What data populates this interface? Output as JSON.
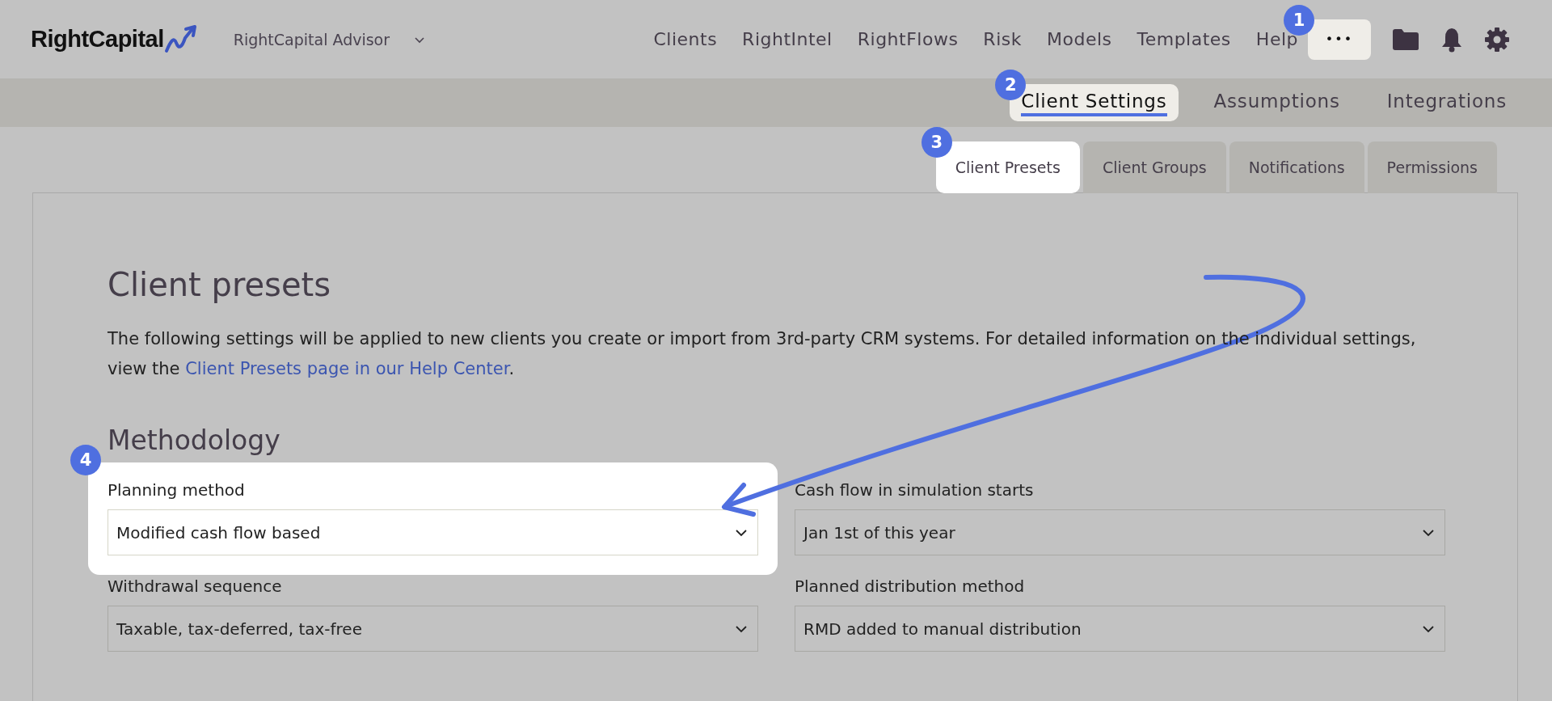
{
  "header": {
    "logo": "RightCapital",
    "account": "RightCapital Advisor",
    "nav": [
      {
        "label": "Clients"
      },
      {
        "label": "RightIntel"
      },
      {
        "label": "RightFlows"
      },
      {
        "label": "Risk"
      },
      {
        "label": "Models"
      },
      {
        "label": "Templates"
      },
      {
        "label": "Help"
      }
    ],
    "more_button": {
      "label": "•••",
      "callout": "1"
    }
  },
  "subnav": [
    {
      "label": "Client Settings",
      "selected": true,
      "callout": "2"
    },
    {
      "label": "Assumptions",
      "selected": false
    },
    {
      "label": "Integrations",
      "selected": false
    }
  ],
  "tabs": [
    {
      "label": "Client Presets",
      "selected": true,
      "callout": "3"
    },
    {
      "label": "Client Groups",
      "selected": false
    },
    {
      "label": "Notifications",
      "selected": false
    },
    {
      "label": "Permissions",
      "selected": false
    }
  ],
  "page": {
    "title": "Client presets",
    "intro": "The following settings will be applied to new clients you create or import from 3rd-party CRM systems. For detailed information on the individual settings, view the ",
    "intro_link": "Client Presets page in our Help Center",
    "intro_end": ".",
    "section": "Methodology",
    "fields": [
      {
        "label": "Planning method",
        "value": "Modified cash flow based",
        "callout": "4"
      },
      {
        "label": "Cash flow in simulation starts",
        "value": "Jan 1st of this year"
      },
      {
        "label": "Withdrawal sequence",
        "value": "Taxable, tax-deferred, tax-free"
      },
      {
        "label": "Planned distribution method",
        "value": "RMD added to manual distribution"
      }
    ]
  }
}
